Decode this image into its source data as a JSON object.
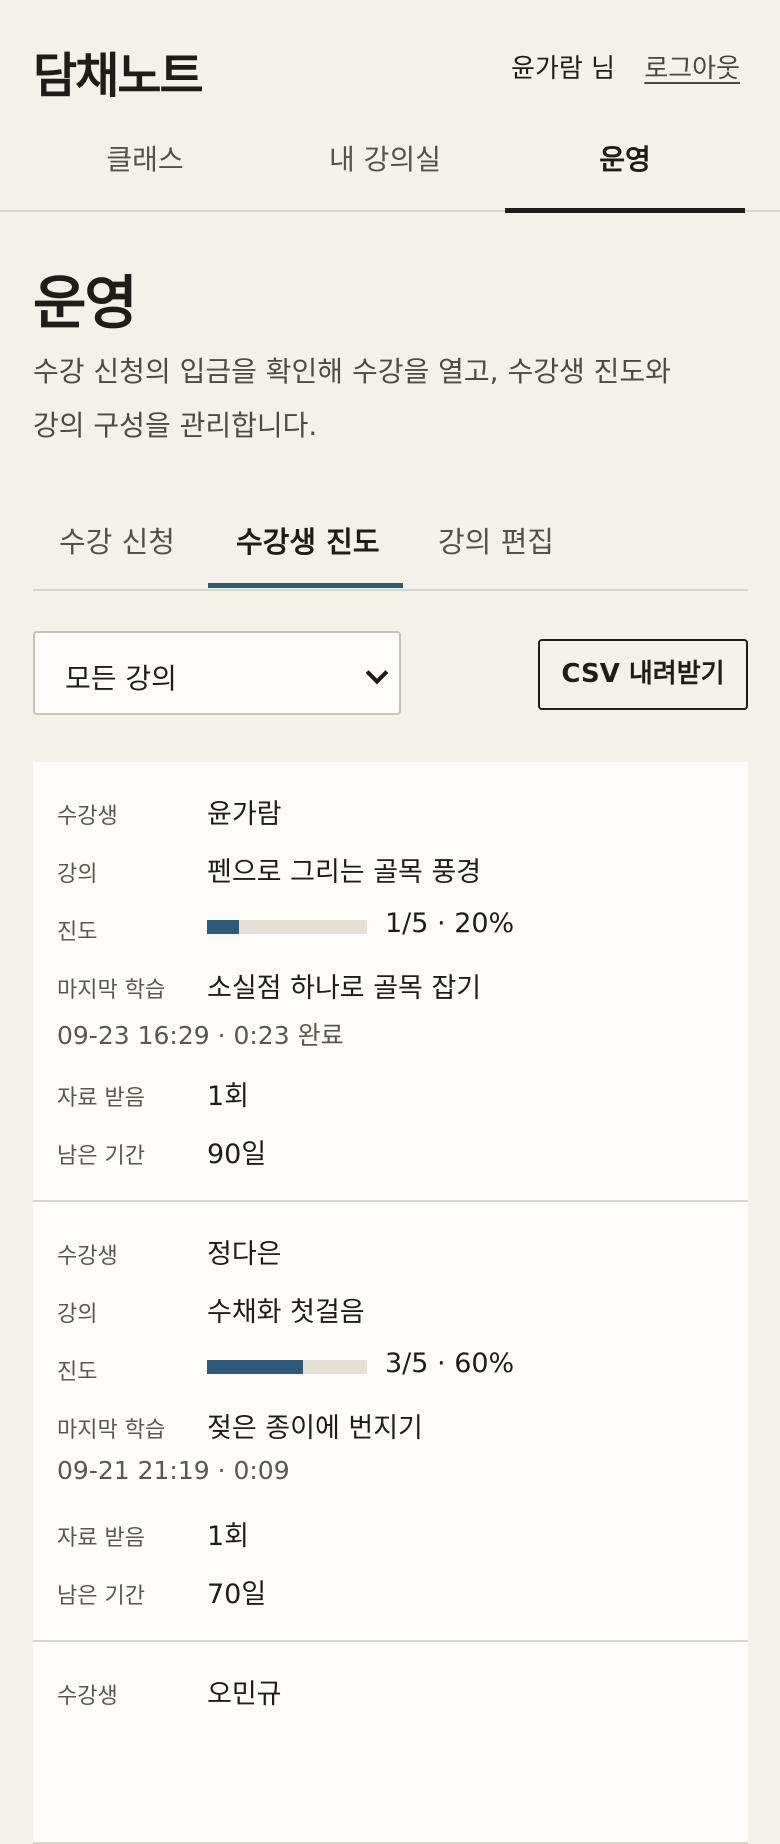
{
  "header": {
    "brand": "담채노트",
    "user": "윤가람 님",
    "logout": "로그아웃"
  },
  "nav": [
    "클래스",
    "내 강의실",
    "운영"
  ],
  "page": {
    "title": "운영",
    "desc_line1": "수강 신청의 입금을 확인해 수강을 열고, 수강생 진도와",
    "desc_line2": "강의 구성을 관리합니다."
  },
  "subtabs": [
    "수강 신청",
    "수강생 진도",
    "강의 편집"
  ],
  "filter": {
    "selected": "모든 강의"
  },
  "csv_label": "CSV 내려받기",
  "labels": {
    "student": "수강생",
    "course": "강의",
    "progress": "진도",
    "last": "마지막 학습",
    "downloads": "자료 받음",
    "remaining": "남은 기간"
  },
  "colors": {
    "accent": "#2c5a78",
    "background": "#f4f1ea",
    "card": "#fdfcf8"
  },
  "records": [
    {
      "student": "윤가람",
      "course": "펜으로 그리는 골목 풍경",
      "progress_fraction": 0.2,
      "progress_text": "1/5 · 20%",
      "last_lesson": "소실점 하나로 골목 잡기",
      "last_meta": "09-23 16:29 · 0:23 완료",
      "downloads": "1회",
      "remaining": "90일"
    },
    {
      "student": "정다은",
      "course": "수채화 첫걸음",
      "progress_fraction": 0.6,
      "progress_text": "3/5 · 60%",
      "last_lesson": "젖은 종이에 번지기",
      "last_meta": "09-21 21:19 · 0:09",
      "downloads": "1회",
      "remaining": "70일"
    },
    {
      "student": "오민규",
      "course": "",
      "progress_fraction": 0,
      "progress_text": "",
      "last_lesson": "",
      "last_meta": "",
      "downloads": "",
      "remaining": ""
    }
  ]
}
